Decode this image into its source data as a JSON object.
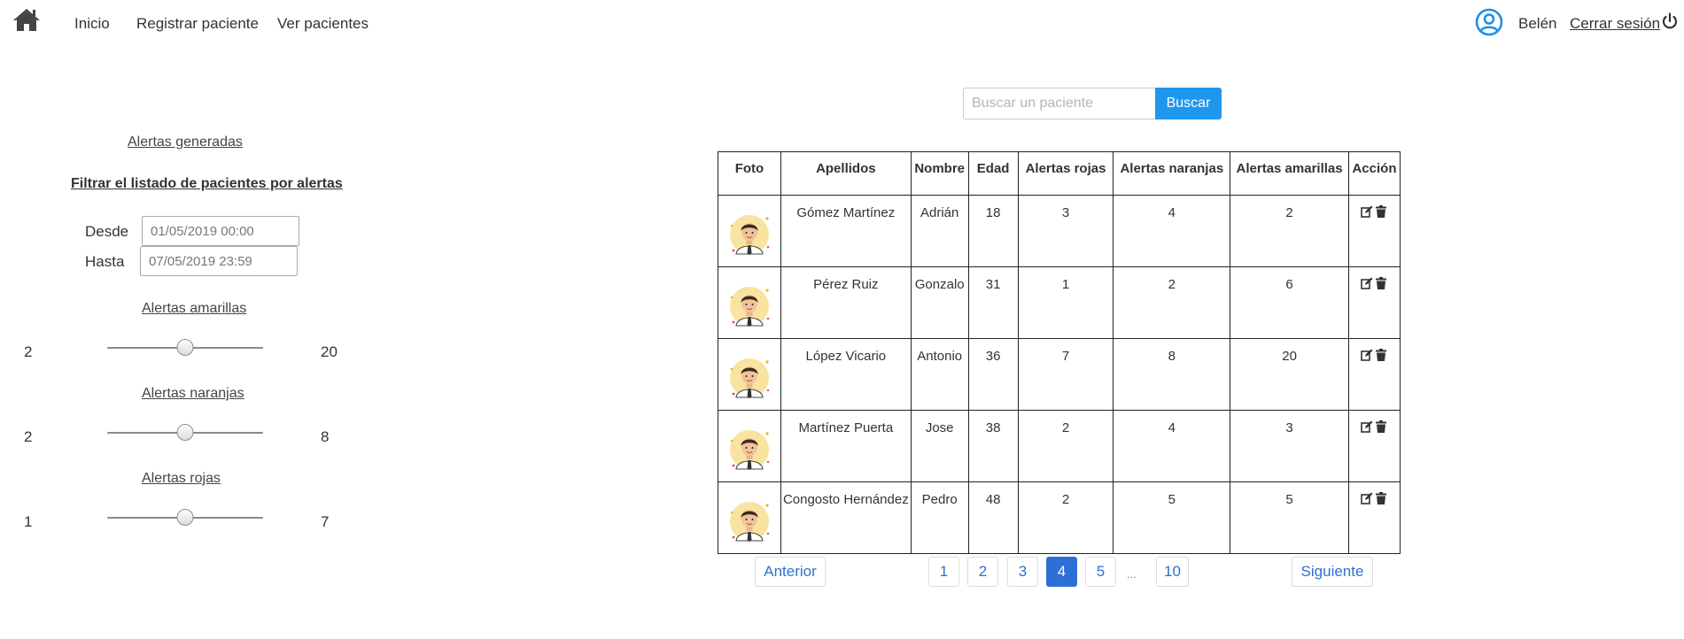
{
  "nav": {
    "links": [
      "Inicio",
      "Registrar paciente",
      "Ver pacientes"
    ],
    "user_name": "Belén",
    "logout_label": "Cerrar sesión"
  },
  "filters": {
    "alerts_link": "Alertas generadas",
    "title": "Filtrar el listado de pacientes por alertas",
    "from_label": "Desde",
    "from_value": "01/05/2019 00:00",
    "to_label": "Hasta",
    "to_value": "07/05/2019 23:59",
    "sliders": [
      {
        "label": "Alertas amarillas",
        "min": "2",
        "max": "20",
        "value": 11
      },
      {
        "label": "Alertas naranjas",
        "min": "2",
        "max": "8",
        "value": 5
      },
      {
        "label": "Alertas rojas",
        "min": "1",
        "max": "7",
        "value": 4
      }
    ]
  },
  "search": {
    "placeholder": "Buscar un paciente",
    "button_label": "Buscar"
  },
  "table": {
    "headers": [
      "Foto",
      "Apellidos",
      "Nombre",
      "Edad",
      "Alertas rojas",
      "Alertas naranjas",
      "Alertas amarillas",
      "Acción"
    ],
    "rows": [
      {
        "apellidos": "Gómez Martínez",
        "nombre": "Adrián",
        "edad": "18",
        "rojas": "3",
        "naranjas": "4",
        "amarillas": "2"
      },
      {
        "apellidos": "Pérez Ruiz",
        "nombre": "Gonzalo",
        "edad": "31",
        "rojas": "1",
        "naranjas": "2",
        "amarillas": "6"
      },
      {
        "apellidos": "López Vicario",
        "nombre": "Antonio",
        "edad": "36",
        "rojas": "7",
        "naranjas": "8",
        "amarillas": "20"
      },
      {
        "apellidos": "Martínez Puerta",
        "nombre": "Jose",
        "edad": "38",
        "rojas": "2",
        "naranjas": "4",
        "amarillas": "3"
      },
      {
        "apellidos": "Congosto Hernández",
        "nombre": "Pedro",
        "edad": "48",
        "rojas": "2",
        "naranjas": "5",
        "amarillas": "5"
      }
    ]
  },
  "pagination": {
    "prev_label": "Anterior",
    "next_label": "Siguiente",
    "pages": [
      "1",
      "2",
      "3",
      "4",
      "5",
      "10"
    ],
    "ellipsis": "...",
    "active_page": "4"
  },
  "colors": {
    "primary": "#1f97ec",
    "active_page": "#2c6fd6",
    "user_icon": "#1e90e6"
  },
  "icons": [
    "home-icon",
    "user-circle-icon",
    "power-icon",
    "avatar-icon",
    "edit-icon",
    "trash-icon"
  ]
}
